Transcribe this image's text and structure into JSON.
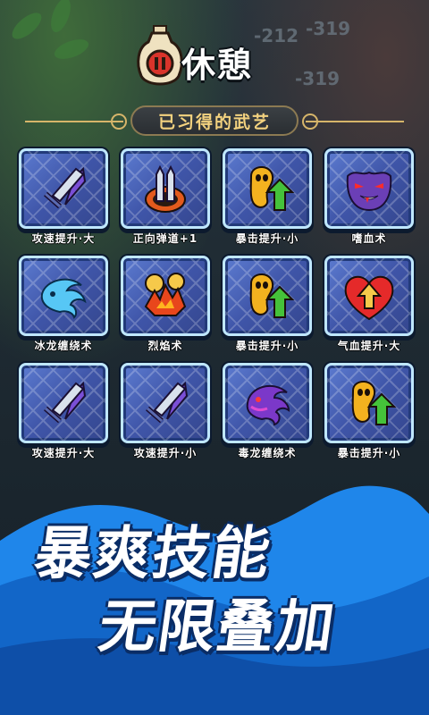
{
  "header": {
    "title": "休憩",
    "section_title": "已习得的武艺"
  },
  "background": {
    "damage_numbers": [
      "-212",
      "-319",
      "-319"
    ]
  },
  "skills": [
    {
      "label": "攻速提升·大",
      "icon": "sword-icon"
    },
    {
      "label": "正向弹道+1",
      "icon": "twin-swords-icon"
    },
    {
      "label": "暴击提升·小",
      "icon": "crit-figure-icon"
    },
    {
      "label": "嗜血术",
      "icon": "vampire-face-icon"
    },
    {
      "label": "冰龙缠绕术",
      "icon": "ice-dragon-icon"
    },
    {
      "label": "烈焰术",
      "icon": "flame-icon"
    },
    {
      "label": "暴击提升·小",
      "icon": "crit-figure-icon"
    },
    {
      "label": "气血提升·大",
      "icon": "heart-up-icon"
    },
    {
      "label": "攻速提升·大",
      "icon": "sword-icon"
    },
    {
      "label": "攻速提升·小",
      "icon": "sword-icon"
    },
    {
      "label": "毒龙缠绕术",
      "icon": "poison-dragon-icon"
    },
    {
      "label": "暴击提升·小",
      "icon": "crit-figure-icon"
    }
  ],
  "promo": {
    "line1": "暴爽技能",
    "line2": "无限叠加"
  },
  "colors": {
    "tile_fill": "#4a63b8",
    "tile_border": "#bfe7ff",
    "banner_text": "#f3d27f",
    "promo_wave": "#1f86ea"
  }
}
